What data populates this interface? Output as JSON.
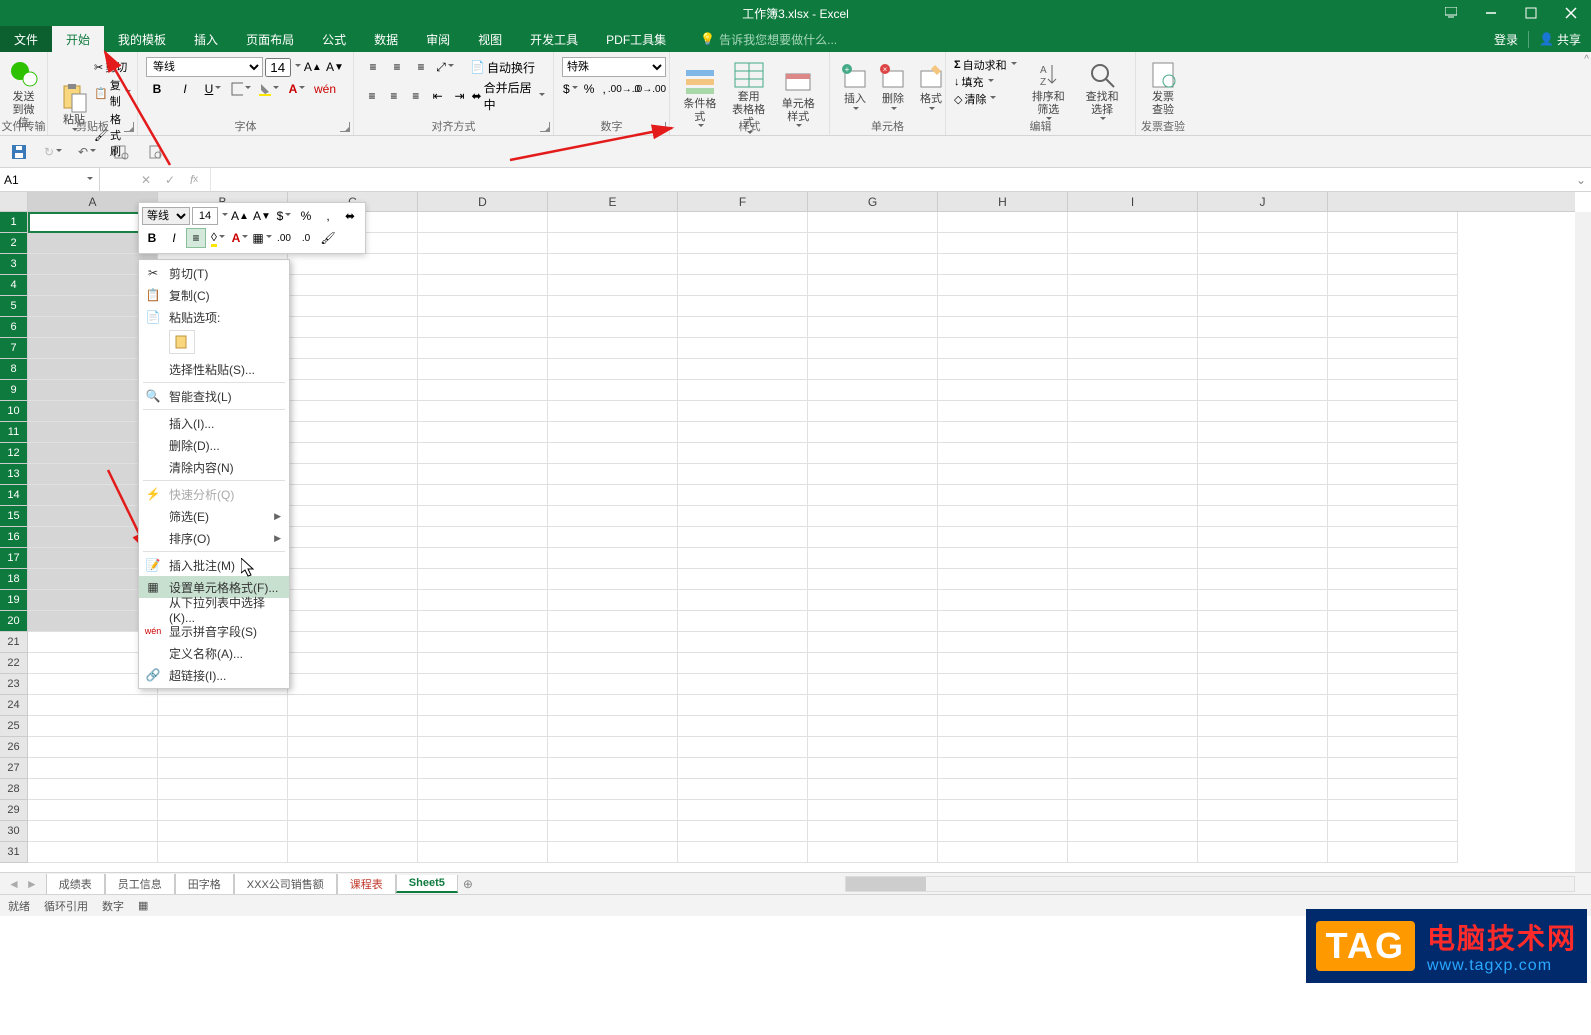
{
  "titlebar": {
    "title": "工作簿3.xlsx - Excel"
  },
  "menubar": {
    "tabs": [
      "文件",
      "开始",
      "我的模板",
      "插入",
      "页面布局",
      "公式",
      "数据",
      "审阅",
      "视图",
      "开发工具",
      "PDF工具集"
    ],
    "tellme": "告诉我您想要做什么...",
    "login": "登录",
    "share": "共享"
  },
  "ribbon": {
    "wechat_group": {
      "label": "文件传输",
      "btn": "发送\n到微信"
    },
    "clipboard": {
      "label": "剪贴板",
      "paste": "粘贴",
      "cut": "剪切",
      "copy": "复制",
      "format_painter": "格式刷"
    },
    "font": {
      "label": "字体",
      "name": "等线",
      "size": "14"
    },
    "align": {
      "label": "对齐方式",
      "wrap": "自动换行",
      "merge": "合并后居中"
    },
    "number": {
      "label": "数字",
      "format": "特殊"
    },
    "styles": {
      "label": "样式",
      "cond": "条件格式",
      "table": "套用\n表格格式",
      "cell": "单元格样式"
    },
    "cells": {
      "label": "单元格",
      "insert": "插入",
      "delete": "删除",
      "format": "格式"
    },
    "editing": {
      "label": "编辑",
      "sum": "自动求和",
      "fill": "填充",
      "clear": "清除",
      "sort": "排序和筛选",
      "find": "查找和选择"
    },
    "invoice": {
      "label": "发票查验",
      "btn": "发票\n查验"
    }
  },
  "namebox": {
    "value": "A1"
  },
  "columns": [
    "A",
    "B",
    "C",
    "D",
    "E",
    "F",
    "G",
    "H",
    "I",
    "J"
  ],
  "rows_visible": [
    1,
    2,
    3,
    4,
    5,
    6,
    7,
    8,
    9,
    10,
    11,
    12,
    13,
    14,
    15,
    16,
    17,
    18,
    19,
    20,
    21,
    22,
    23,
    24,
    25,
    26,
    27,
    28,
    29,
    30,
    31
  ],
  "mini_toolbar": {
    "font": "等线",
    "size": "14"
  },
  "context_menu": {
    "cut": "剪切(T)",
    "copy": "复制(C)",
    "paste_options": "粘贴选项:",
    "paste_special": "选择性粘贴(S)...",
    "smart_lookup": "智能查找(L)",
    "insert": "插入(I)...",
    "delete": "删除(D)...",
    "clear_contents": "清除内容(N)",
    "quick_analysis": "快速分析(Q)",
    "filter": "筛选(E)",
    "sort": "排序(O)",
    "insert_comment": "插入批注(M)",
    "format_cells": "设置单元格格式(F)...",
    "pick_from_list": "从下拉列表中选择(K)...",
    "show_phonetic": "显示拼音字段(S)",
    "define_name": "定义名称(A)...",
    "hyperlink": "超链接(I)..."
  },
  "sheettabs": {
    "tabs": [
      "成绩表",
      "员工信息",
      "田字格",
      "XXX公司销售额",
      "课程表",
      "Sheet5"
    ],
    "active": "Sheet5"
  },
  "statusbar": {
    "ready": "就绪",
    "circular": "循环引用",
    "numfmt": "数字"
  },
  "watermark": {
    "tag": "TAG",
    "line1": "电脑技术网",
    "line2": "www.tagxp.com"
  },
  "chart_data": null
}
